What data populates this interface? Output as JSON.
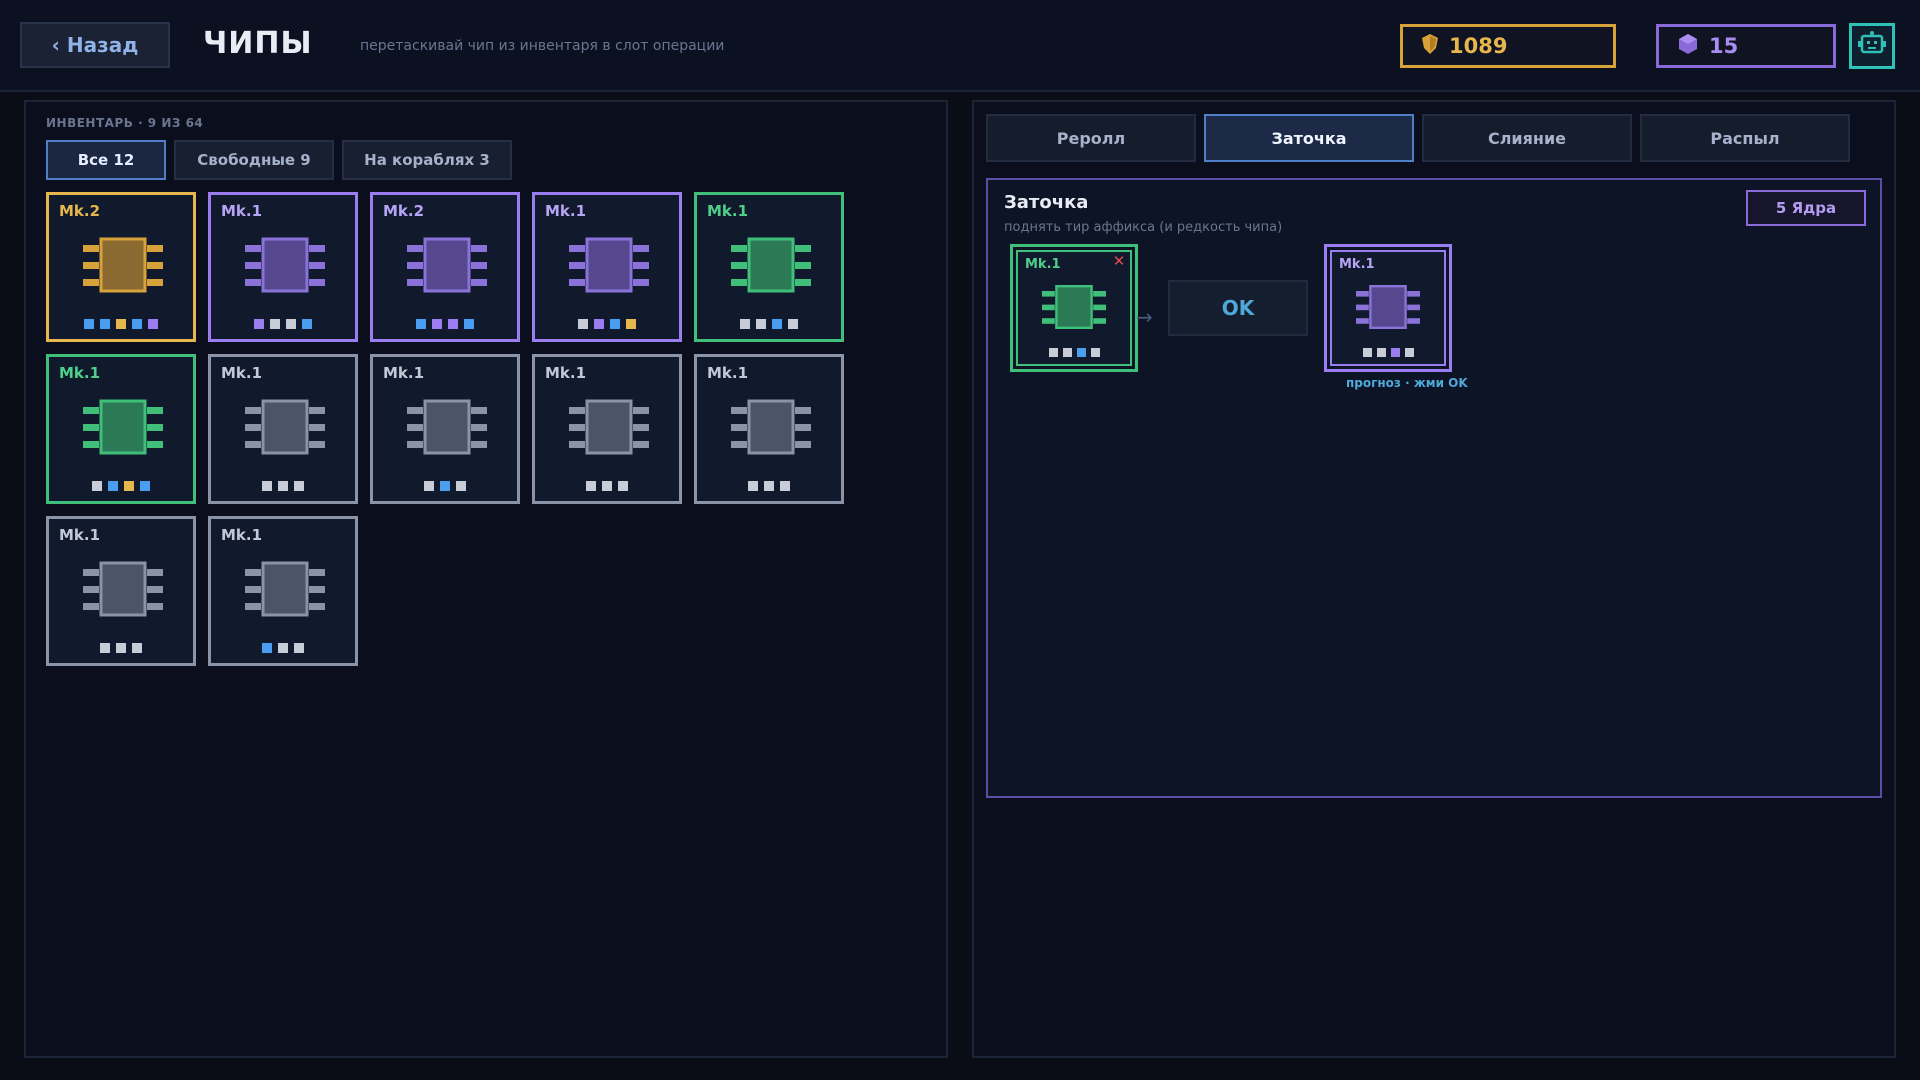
{
  "header": {
    "back_label": "‹ Назад",
    "title": "ЧИПЫ",
    "hint": "перетаскивай чип из инвентаря в слот операции",
    "gold": "1089",
    "cores": "15",
    "gold_icon": "gold-shield-icon",
    "core_icon": "hexagon-core-icon",
    "robot_icon": "robot-icon"
  },
  "inventory": {
    "label": "ИНВЕНТАРЬ · 9 ИЗ 64",
    "filters": [
      {
        "label": "Все 12",
        "active": true
      },
      {
        "label": "Свободные 9",
        "active": false
      },
      {
        "label": "На кораблях 3",
        "active": false
      }
    ],
    "chips": [
      {
        "mk": "Mk.2",
        "rarity": "gold",
        "dots": [
          "blue",
          "blue",
          "gold",
          "blue",
          "purple"
        ]
      },
      {
        "mk": "Mk.1",
        "rarity": "purple",
        "dots": [
          "purple",
          "gray",
          "gray",
          "blue"
        ]
      },
      {
        "mk": "Mk.2",
        "rarity": "purple",
        "dots": [
          "blue",
          "purple",
          "purple",
          "blue"
        ]
      },
      {
        "mk": "Mk.1",
        "rarity": "purple",
        "dots": [
          "gray",
          "purple",
          "blue",
          "gold"
        ]
      },
      {
        "mk": "Mk.1",
        "rarity": "green",
        "dots": [
          "gray",
          "gray",
          "blue",
          "gray"
        ]
      },
      {
        "mk": "Mk.1",
        "rarity": "green",
        "dots": [
          "gray",
          "blue",
          "gold",
          "blue"
        ]
      },
      {
        "mk": "Mk.1",
        "rarity": "gray",
        "dots": [
          "gray",
          "gray",
          "gray"
        ]
      },
      {
        "mk": "Mk.1",
        "rarity": "gray",
        "dots": [
          "gray",
          "blue",
          "gray"
        ]
      },
      {
        "mk": "Mk.1",
        "rarity": "gray",
        "dots": [
          "gray",
          "gray",
          "gray"
        ]
      },
      {
        "mk": "Mk.1",
        "rarity": "gray",
        "dots": [
          "gray",
          "gray",
          "gray"
        ]
      },
      {
        "mk": "Mk.1",
        "rarity": "gray",
        "dots": [
          "gray",
          "gray",
          "gray"
        ]
      },
      {
        "mk": "Mk.1",
        "rarity": "gray",
        "dots": [
          "blue",
          "gray",
          "gray"
        ]
      }
    ]
  },
  "operations": {
    "tabs": [
      {
        "label": "Реролл",
        "active": false
      },
      {
        "label": "Заточка",
        "active": true
      },
      {
        "label": "Слияние",
        "active": false
      },
      {
        "label": "Распыл",
        "active": false
      }
    ],
    "title": "Заточка",
    "subtitle": "поднять тир аффикса (и редкость чипа)",
    "cost_label": "5 Ядра",
    "input_chip": {
      "mk": "Mk.1",
      "rarity": "green",
      "dots": [
        "gray",
        "gray",
        "blue",
        "gray"
      ]
    },
    "remove_label": "✕",
    "arrow": "→",
    "ok_label": "OK",
    "output_chip": {
      "mk": "Mk.1",
      "rarity": "purple",
      "dots": [
        "gray",
        "gray",
        "purple",
        "gray"
      ]
    },
    "forecast_label": "прогноз · жми OK"
  },
  "colors": {
    "gold": "#e7b64c",
    "purple": "#9a7ef0",
    "green": "#3fbf7a",
    "gray": "#8a93a8",
    "blue": "#4a9ef0",
    "accent_blue": "#4f7fc7"
  }
}
